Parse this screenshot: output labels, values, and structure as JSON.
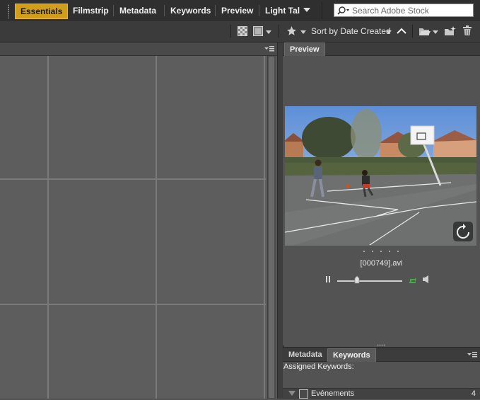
{
  "workspaces": {
    "tabs": [
      {
        "label": "Essentials",
        "active": true
      },
      {
        "label": "Filmstrip"
      },
      {
        "label": "Metadata"
      },
      {
        "label": "Keywords"
      },
      {
        "label": "Preview"
      },
      {
        "label": "Light Tal"
      }
    ]
  },
  "search": {
    "placeholder": "Search Adobe Stock"
  },
  "toolbar": {
    "sort_label": "Sort by Date Created"
  },
  "preview": {
    "tab_label": "Preview",
    "file_name": "[000749].avi",
    "video_progress": 0.3
  },
  "keywords_panel": {
    "tabs": [
      {
        "label": "Metadata"
      },
      {
        "label": "Keywords",
        "active": true
      }
    ],
    "assigned_label": "Assigned Keywords:",
    "category_label": "Evénements",
    "category_count": "4"
  },
  "colors": {
    "workspace_active": "#d29d18",
    "panel_bg": "#535353",
    "play_green": "#3ab53a"
  },
  "icons": [
    "grip-icon",
    "chevron-down-icon",
    "search-icon",
    "thumbnail-quality-icon",
    "view-mode-icon",
    "star-icon",
    "sort-ascending-icon",
    "open-folder-icon",
    "new-folder-icon",
    "trash-icon",
    "panel-menu-icon",
    "loop-icon",
    "pause-icon",
    "volume-icon",
    "reload-icon",
    "disclosure-triangle-icon"
  ]
}
